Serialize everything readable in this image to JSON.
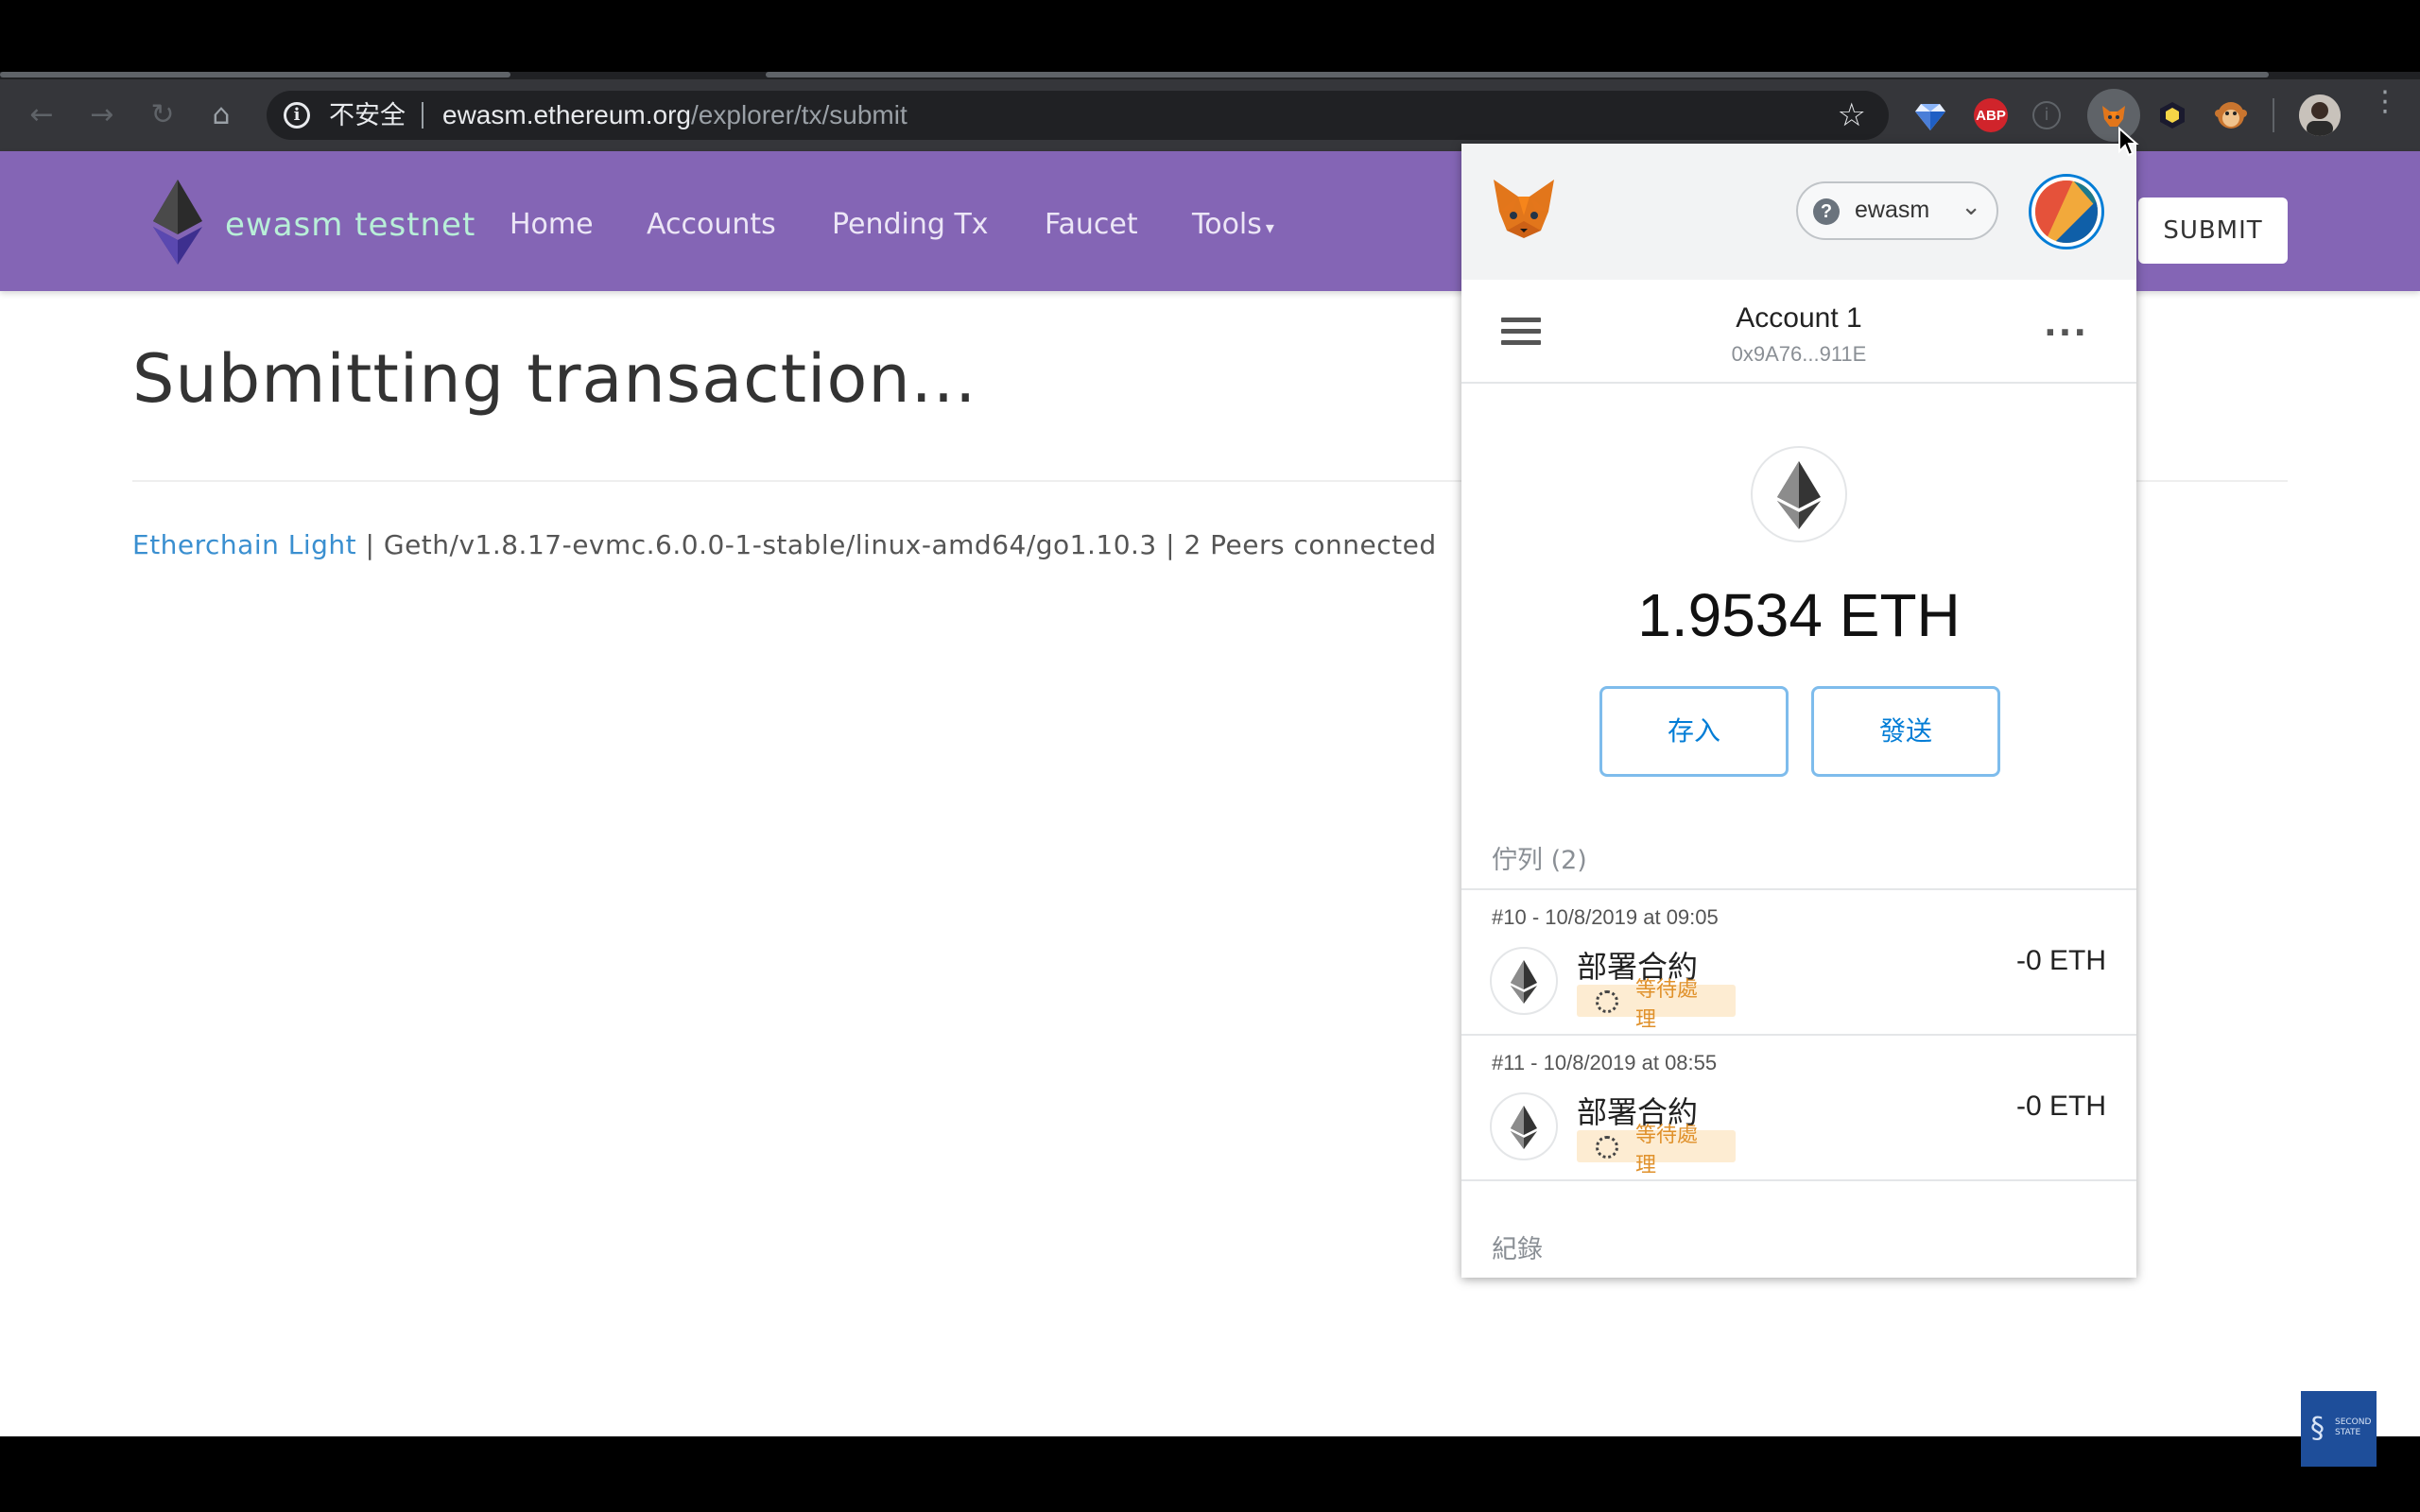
{
  "browser": {
    "security_label": "不安全",
    "url_host": "ewasm.ethereum.org",
    "url_path": "/explorer/tx/submit",
    "extensions": [
      "gem-extension-icon",
      "adblock-plus-icon",
      "info-extension-icon",
      "metamask-extension-icon",
      "hexagon-extension-icon",
      "monkey-extension-icon"
    ],
    "adblock_label": "ABP"
  },
  "site": {
    "brand": "ewasm testnet",
    "nav": {
      "home": "Home",
      "accounts": "Accounts",
      "pending": "Pending Tx",
      "faucet": "Faucet",
      "tools": "Tools",
      "tools_caret": "▾"
    },
    "submit_label": "SUBMIT",
    "heading": "Submitting transaction...",
    "footer": {
      "link": "Etherchain Light",
      "info": " | Geth/v1.8.17-evmc.6.0.0-1-stable/linux-amd64/go1.10.3 | 2 Peers connected"
    },
    "colors": {
      "navbar": "#8465b5",
      "brand_text": "#b8efd8",
      "link": "#3a8fd0"
    }
  },
  "metamask": {
    "network": "ewasm",
    "account_name": "Account 1",
    "account_address": "0x9A76...911E",
    "balance": "1.9534 ETH",
    "deposit_label": "存入",
    "send_label": "發送",
    "queue_label": "佇列 (2)",
    "history_label": "紀錄",
    "transactions": [
      {
        "date": "#10 - 10/8/2019 at 09:05",
        "title": "部署合約",
        "status": "等待處理",
        "amount": "-0 ETH"
      },
      {
        "date": "#11 - 10/8/2019 at 08:55",
        "title": "部署合約",
        "status": "等待處理",
        "amount": "-0 ETH"
      }
    ],
    "colors": {
      "accent": "#037dd6",
      "pending": "#e0912b",
      "pending_bg": "#fdecd2"
    }
  },
  "watermark": {
    "line1": "SECOND",
    "line2": "STATE"
  }
}
